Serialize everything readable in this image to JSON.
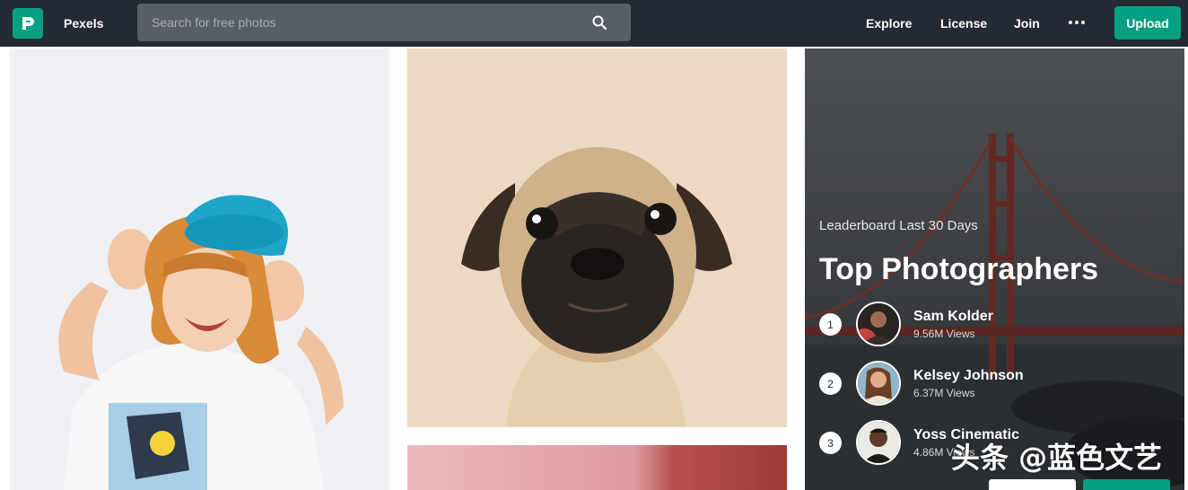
{
  "header": {
    "brand": "Pexels",
    "search_placeholder": "Search for free photos",
    "nav": [
      "Explore",
      "License",
      "Join"
    ],
    "upload_label": "Upload",
    "colors": {
      "bar": "#232a34",
      "accent": "#05a081"
    }
  },
  "photos": [
    {
      "name": "woman-blue-beret-photo"
    },
    {
      "name": "pug-puppy-photo"
    },
    {
      "name": "pink-wall-photo"
    }
  ],
  "leaderboard": {
    "subtitle": "Leaderboard Last 30 Days",
    "title": "Top Photographers",
    "photographers": [
      {
        "rank": "1",
        "name": "Sam Kolder",
        "views": "9.56M Views"
      },
      {
        "rank": "2",
        "name": "Kelsey Johnson",
        "views": "6.37M Views"
      },
      {
        "rank": "3",
        "name": "Yoss Cinematic",
        "views": "4.86M Views"
      }
    ]
  },
  "watermark": "头条 @蓝色文艺"
}
